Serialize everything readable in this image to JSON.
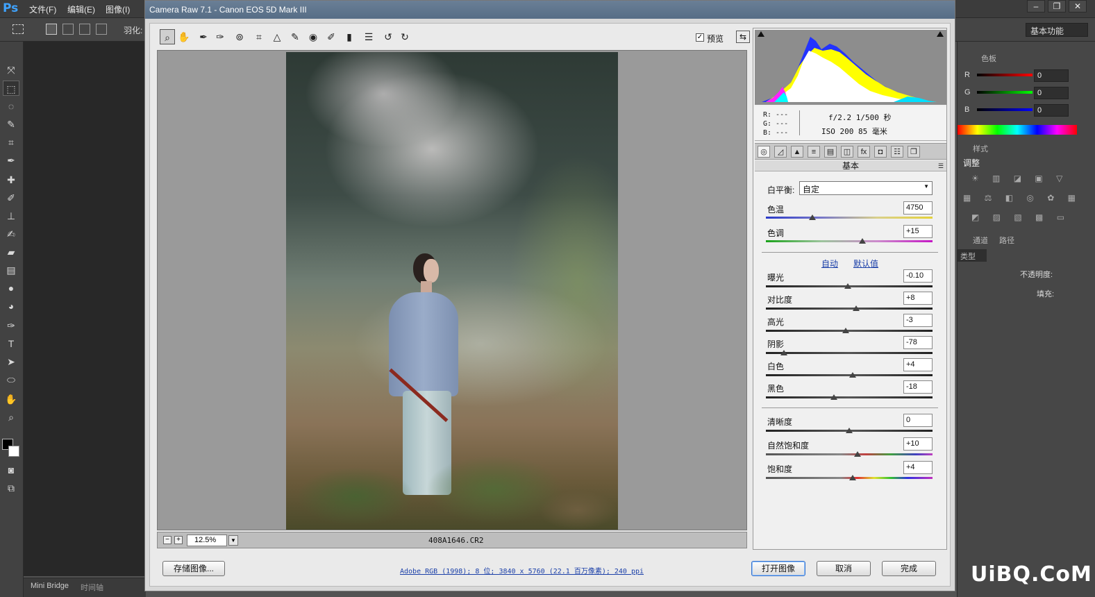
{
  "ps": {
    "logo": "Ps",
    "menus": [
      "文件(F)",
      "编辑(E)",
      "图像(I)"
    ],
    "feather_label": "羽化:",
    "workspace": "基本功能",
    "bottom_tabs": [
      "Mini Bridge",
      "时间轴"
    ],
    "right_panel": {
      "color_tab": "色板",
      "channels": [
        {
          "label": "R",
          "value": "0"
        },
        {
          "label": "G",
          "value": "0"
        },
        {
          "label": "B",
          "value": "0"
        }
      ],
      "styles_tab": "样式",
      "adjust_tab": "调整",
      "channels_tab": "通道",
      "paths_tab": "路径",
      "layer_kind": "类型",
      "opacity_label": "不透明度:",
      "fill_label": "填充:"
    },
    "watermark": "UiBQ.CoM"
  },
  "cr": {
    "title": "Camera Raw 7.1 -  Canon EOS 5D Mark III",
    "preview_label": "预览",
    "zoom": "12.5%",
    "filename": "408A1646.CR2",
    "exif": {
      "r": "R:  ---",
      "g": "G:  ---",
      "b": "B:  ---",
      "line1": "f/2.2   1/500 秒",
      "line2": "ISO 200   85 毫米"
    },
    "section": "基本",
    "wb_label": "白平衡:",
    "wb_value": "自定",
    "temp": {
      "label": "色温",
      "value": "4750",
      "pos": 0.28
    },
    "tint": {
      "label": "色调",
      "value": "+15",
      "pos": 0.58
    },
    "auto_link": "自动",
    "default_link": "默认值",
    "controls": [
      {
        "label": "曝光",
        "value": "-0.10",
        "pos": 0.49
      },
      {
        "label": "对比度",
        "value": "+8",
        "pos": 0.54
      },
      {
        "label": "高光",
        "value": "-3",
        "pos": 0.48
      },
      {
        "label": "阴影",
        "value": "-78",
        "pos": 0.11
      },
      {
        "label": "白色",
        "value": "+4",
        "pos": 0.52
      },
      {
        "label": "黑色",
        "value": "-18",
        "pos": 0.41
      }
    ],
    "presence": [
      {
        "label": "清晰度",
        "value": "0",
        "pos": 0.5
      },
      {
        "label": "自然饱和度",
        "value": "+10",
        "pos": 0.55
      },
      {
        "label": "饱和度",
        "value": "+4",
        "pos": 0.52
      }
    ],
    "save_btn": "存储图像...",
    "workflow": "Adobe RGB (1998); 8 位; 3840 x 5760 (22.1 百万像素); 240 ppi",
    "open_btn": "打开图像",
    "cancel_btn": "取消",
    "done_btn": "完成"
  }
}
